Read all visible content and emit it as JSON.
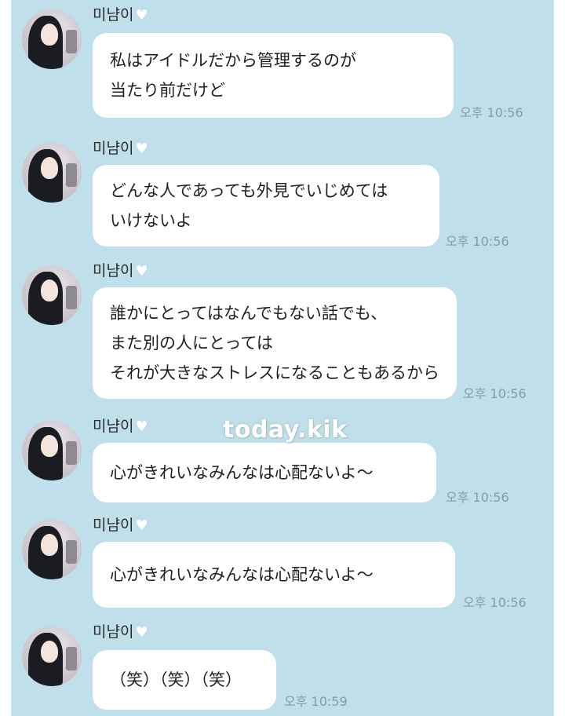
{
  "sender_name": "미냠이",
  "messages": [
    {
      "lines": [
        "私はアイドルだから管理するのが",
        "当たり前だけど"
      ],
      "time": "오후 10:56"
    },
    {
      "lines": [
        "どんな人であっても外見でいじめては",
        "いけないよ"
      ],
      "time": "오후 10:56"
    },
    {
      "lines": [
        "誰かにとってはなんでもない話でも、",
        "また別の人にとっては",
        "それが大きなストレスになることもあるから"
      ],
      "time": "오후 10:56"
    },
    {
      "lines": [
        "心がきれいなみんなは心配ないよ〜"
      ],
      "time": "오후 10:56"
    },
    {
      "lines": [
        "心がきれいなみんなは心配ないよ〜"
      ],
      "time": "오후 10:56"
    },
    {
      "lines": [
        "（笑）（笑）（笑）"
      ],
      "time": "오후 10:59"
    }
  ],
  "watermark": "today.kik",
  "icons": {
    "avatar": "profile-photo",
    "heart": "white-heart-icon"
  },
  "colors": {
    "chat_background": "#bfe0ea",
    "bubble": "#ffffff",
    "timestamp": "#8a9aa2"
  }
}
